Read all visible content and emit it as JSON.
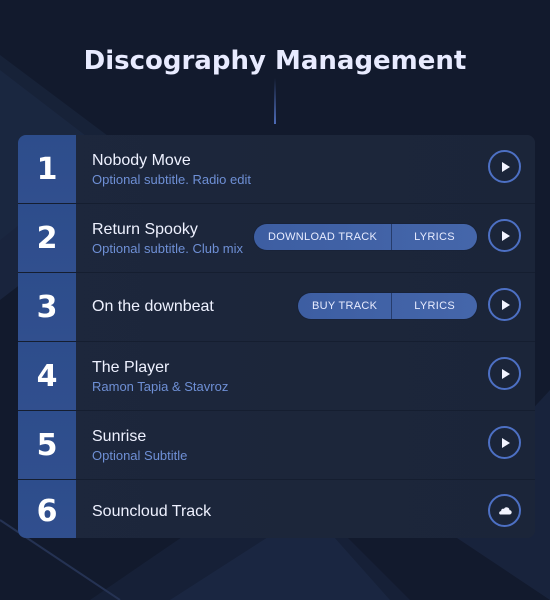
{
  "page": {
    "title": "Discography Management"
  },
  "tracks": [
    {
      "number": "1",
      "title": "Nobody Move",
      "subtitle": "Optional subtitle. Radio edit",
      "buttons": [],
      "action_icon": "play-icon"
    },
    {
      "number": "2",
      "title": "Return Spooky",
      "subtitle": "Optional subtitle. Club mix",
      "buttons": [
        "DOWNLOAD TRACK",
        "LYRICS"
      ],
      "action_icon": "play-icon"
    },
    {
      "number": "3",
      "title": "On the downbeat",
      "subtitle": "",
      "buttons": [
        "BUY TRACK",
        "LYRICS"
      ],
      "action_icon": "play-icon"
    },
    {
      "number": "4",
      "title": "The Player",
      "subtitle": "Ramon Tapia & Stavroz",
      "buttons": [],
      "action_icon": "play-icon"
    },
    {
      "number": "5",
      "title": "Sunrise",
      "subtitle": "Optional Subtitle",
      "buttons": [],
      "action_icon": "play-icon"
    },
    {
      "number": "6",
      "title": "Souncloud Track",
      "subtitle": "",
      "buttons": [],
      "action_icon": "soundcloud-icon"
    }
  ],
  "colors": {
    "background": "#121a2d",
    "row_background": "#1b2539",
    "number_box": "#2d4d8c",
    "accent": "#4d70c4",
    "subtitle_text": "#6e8fd5",
    "button_pill": "#3d5ea2"
  }
}
